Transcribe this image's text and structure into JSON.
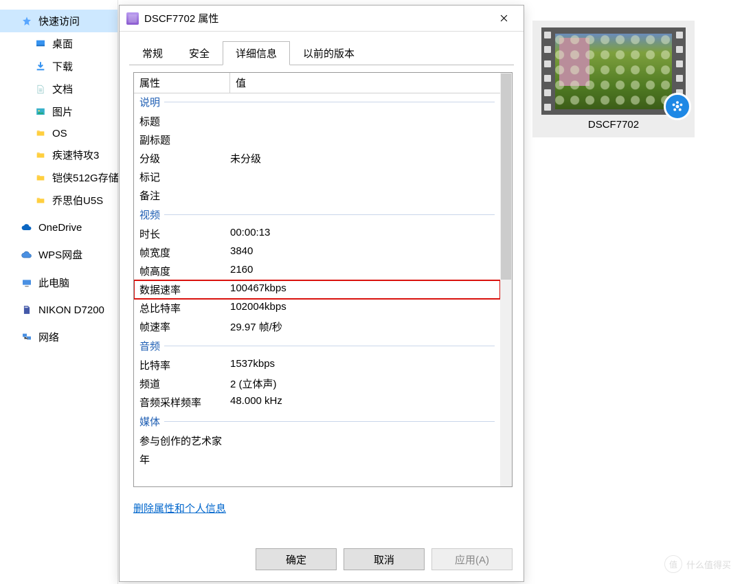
{
  "sidebar": {
    "quick_access": "快速访问",
    "items": [
      {
        "label": "桌面",
        "icon": "desktop"
      },
      {
        "label": "下载",
        "icon": "download"
      },
      {
        "label": "文档",
        "icon": "document"
      },
      {
        "label": "图片",
        "icon": "picture"
      },
      {
        "label": "OS",
        "icon": "folder"
      },
      {
        "label": "疾速特攻3",
        "icon": "folder"
      },
      {
        "label": "铠侠512G存储",
        "icon": "folder"
      },
      {
        "label": "乔思伯U5S",
        "icon": "folder"
      }
    ],
    "onedrive": "OneDrive",
    "wps": "WPS网盘",
    "thispc": "此电脑",
    "nikon": "NIKON D7200",
    "network": "网络"
  },
  "dialog": {
    "title": "DSCF7702 属性",
    "tabs": [
      "常规",
      "安全",
      "详细信息",
      "以前的版本"
    ],
    "active_tab": 2,
    "header_prop": "属性",
    "header_val": "值",
    "del_link": "删除属性和个人信息",
    "ok": "确定",
    "cancel": "取消",
    "apply": "应用(A)"
  },
  "props": {
    "sections": [
      {
        "title": "说明",
        "rows": [
          {
            "l": "标题",
            "v": ""
          },
          {
            "l": "副标题",
            "v": ""
          },
          {
            "l": "分级",
            "v": "未分级"
          },
          {
            "l": "标记",
            "v": ""
          },
          {
            "l": "备注",
            "v": ""
          }
        ]
      },
      {
        "title": "视频",
        "rows": [
          {
            "l": "时长",
            "v": "00:00:13"
          },
          {
            "l": "帧宽度",
            "v": "3840"
          },
          {
            "l": "帧高度",
            "v": "2160"
          },
          {
            "l": "数据速率",
            "v": "100467kbps",
            "highlight": true
          },
          {
            "l": "总比特率",
            "v": "102004kbps"
          },
          {
            "l": "帧速率",
            "v": "29.97 帧/秒"
          }
        ]
      },
      {
        "title": "音频",
        "rows": [
          {
            "l": "比特率",
            "v": "1537kbps"
          },
          {
            "l": "频道",
            "v": "2 (立体声)"
          },
          {
            "l": "音频采样频率",
            "v": "48.000 kHz"
          }
        ]
      },
      {
        "title": "媒体",
        "rows": [
          {
            "l": "参与创作的艺术家",
            "v": ""
          },
          {
            "l": "年",
            "v": ""
          }
        ]
      }
    ]
  },
  "file": {
    "name": "DSCF7702"
  },
  "watermark": "什么值得买"
}
